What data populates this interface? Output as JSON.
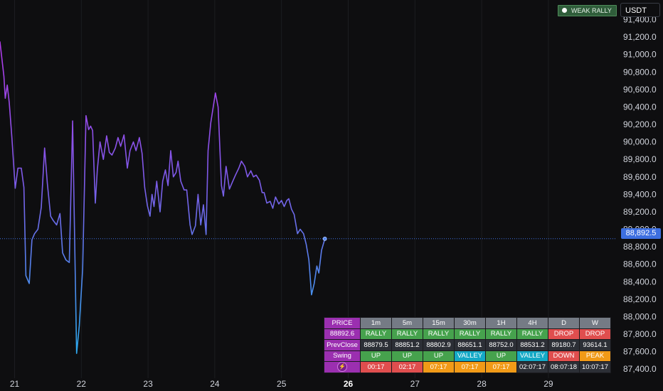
{
  "chart_data": {
    "type": "line",
    "x_ticks": [
      {
        "x": 21,
        "label": "21",
        "bold": false
      },
      {
        "x": 22,
        "label": "22",
        "bold": false
      },
      {
        "x": 23,
        "label": "23",
        "bold": false
      },
      {
        "x": 24,
        "label": "24",
        "bold": false
      },
      {
        "x": 25,
        "label": "25",
        "bold": false
      },
      {
        "x": 26,
        "label": "26",
        "bold": true
      },
      {
        "x": 27,
        "label": "27",
        "bold": false
      },
      {
        "x": 28,
        "label": "28",
        "bold": false
      },
      {
        "x": 29,
        "label": "29",
        "bold": false
      }
    ],
    "y_ticks": [
      {
        "v": 91400,
        "label": "91,400.0"
      },
      {
        "v": 91200,
        "label": "91,200.0"
      },
      {
        "v": 91000,
        "label": "91,000.0"
      },
      {
        "v": 90800,
        "label": "90,800.0"
      },
      {
        "v": 90600,
        "label": "90,600.0"
      },
      {
        "v": 90400,
        "label": "90,400.0"
      },
      {
        "v": 90200,
        "label": "90,200.0"
      },
      {
        "v": 90000,
        "label": "90,000.0"
      },
      {
        "v": 89800,
        "label": "89,800.0"
      },
      {
        "v": 89600,
        "label": "89,600.0"
      },
      {
        "v": 89400,
        "label": "89,400.0"
      },
      {
        "v": 89200,
        "label": "89,200.0"
      },
      {
        "v": 89000,
        "label": "89,000.0"
      },
      {
        "v": 88800,
        "label": "88,800.0"
      },
      {
        "v": 88600,
        "label": "88,600.0"
      },
      {
        "v": 88400,
        "label": "88,400.0"
      },
      {
        "v": 88200,
        "label": "88,200.0"
      },
      {
        "v": 88000,
        "label": "88,000.0"
      },
      {
        "v": 87800,
        "label": "87,800.0"
      },
      {
        "v": 87600,
        "label": "87,600.0"
      },
      {
        "v": 87400,
        "label": "87,400.0"
      }
    ],
    "ylim": [
      87296,
      91624
    ],
    "xlim": [
      20.78,
      30.0
    ],
    "last_price": 88892.5,
    "last_price_label": "88,892.5",
    "points": [
      [
        20.78,
        91150
      ],
      [
        20.84,
        90750
      ],
      [
        20.86,
        90500
      ],
      [
        20.89,
        90650
      ],
      [
        20.92,
        90450
      ],
      [
        20.96,
        90050
      ],
      [
        21.01,
        89470
      ],
      [
        21.05,
        89700
      ],
      [
        21.1,
        89700
      ],
      [
        21.14,
        89480
      ],
      [
        21.17,
        88470
      ],
      [
        21.22,
        88380
      ],
      [
        21.26,
        88880
      ],
      [
        21.3,
        88950
      ],
      [
        21.35,
        89000
      ],
      [
        21.4,
        89250
      ],
      [
        21.45,
        89930
      ],
      [
        21.49,
        89530
      ],
      [
        21.54,
        89150
      ],
      [
        21.58,
        89100
      ],
      [
        21.63,
        89050
      ],
      [
        21.68,
        89180
      ],
      [
        21.72,
        88730
      ],
      [
        21.77,
        88650
      ],
      [
        21.82,
        88620
      ],
      [
        21.87,
        90240
      ],
      [
        21.9,
        88900
      ],
      [
        21.93,
        87580
      ],
      [
        21.97,
        87900
      ],
      [
        22.02,
        88550
      ],
      [
        22.07,
        90300
      ],
      [
        22.11,
        90140
      ],
      [
        22.14,
        90180
      ],
      [
        22.17,
        90130
      ],
      [
        22.21,
        89300
      ],
      [
        22.24,
        89680
      ],
      [
        22.28,
        90000
      ],
      [
        22.33,
        89800
      ],
      [
        22.38,
        90070
      ],
      [
        22.42,
        89880
      ],
      [
        22.46,
        89850
      ],
      [
        22.51,
        89930
      ],
      [
        22.55,
        90050
      ],
      [
        22.59,
        89950
      ],
      [
        22.64,
        90080
      ],
      [
        22.69,
        89700
      ],
      [
        22.73,
        89900
      ],
      [
        22.78,
        90000
      ],
      [
        22.82,
        89900
      ],
      [
        22.87,
        90050
      ],
      [
        22.91,
        89870
      ],
      [
        22.95,
        89480
      ],
      [
        22.99,
        89270
      ],
      [
        23.03,
        89150
      ],
      [
        23.06,
        89400
      ],
      [
        23.09,
        89260
      ],
      [
        23.13,
        89550
      ],
      [
        23.18,
        89200
      ],
      [
        23.22,
        89550
      ],
      [
        23.26,
        89680
      ],
      [
        23.3,
        89500
      ],
      [
        23.34,
        89900
      ],
      [
        23.38,
        89600
      ],
      [
        23.42,
        89650
      ],
      [
        23.45,
        89780
      ],
      [
        23.49,
        89550
      ],
      [
        23.54,
        89450
      ],
      [
        23.58,
        89450
      ],
      [
        23.63,
        89050
      ],
      [
        23.66,
        88940
      ],
      [
        23.71,
        89040
      ],
      [
        23.75,
        89400
      ],
      [
        23.79,
        89050
      ],
      [
        23.83,
        89280
      ],
      [
        23.87,
        88940
      ],
      [
        23.9,
        89900
      ],
      [
        23.94,
        90220
      ],
      [
        24.01,
        90560
      ],
      [
        24.05,
        90400
      ],
      [
        24.1,
        89500
      ],
      [
        24.13,
        89380
      ],
      [
        24.17,
        89720
      ],
      [
        24.22,
        89460
      ],
      [
        24.27,
        89550
      ],
      [
        24.31,
        89620
      ],
      [
        24.36,
        89700
      ],
      [
        24.4,
        89780
      ],
      [
        24.45,
        89720
      ],
      [
        24.49,
        89600
      ],
      [
        24.54,
        89670
      ],
      [
        24.58,
        89600
      ],
      [
        24.62,
        89620
      ],
      [
        24.67,
        89560
      ],
      [
        24.71,
        89420
      ],
      [
        24.74,
        89420
      ],
      [
        24.78,
        89300
      ],
      [
        24.83,
        89320
      ],
      [
        24.87,
        89240
      ],
      [
        24.91,
        89370
      ],
      [
        24.96,
        89290
      ],
      [
        25.0,
        89330
      ],
      [
        25.04,
        89260
      ],
      [
        25.08,
        89330
      ],
      [
        25.11,
        89350
      ],
      [
        25.15,
        89230
      ],
      [
        25.19,
        89170
      ],
      [
        25.24,
        88950
      ],
      [
        25.28,
        89000
      ],
      [
        25.33,
        88950
      ],
      [
        25.37,
        88830
      ],
      [
        25.41,
        88650
      ],
      [
        25.45,
        88250
      ],
      [
        25.49,
        88380
      ],
      [
        25.53,
        88580
      ],
      [
        25.56,
        88500
      ],
      [
        25.6,
        88760
      ],
      [
        25.65,
        88892
      ]
    ]
  },
  "currency_label": "USDT",
  "status_badge": "WEAK RALLY",
  "table": {
    "headers": [
      "PRICE",
      "1m",
      "5m",
      "15m",
      "30m",
      "1H",
      "4H",
      "D",
      "W"
    ],
    "rows": [
      {
        "label": "88892.6",
        "cells": [
          {
            "text": "RALLY",
            "color": "green"
          },
          {
            "text": "RALLY",
            "color": "green"
          },
          {
            "text": "RALLY",
            "color": "green"
          },
          {
            "text": "RALLY",
            "color": "green"
          },
          {
            "text": "RALLY",
            "color": "green"
          },
          {
            "text": "RALLY",
            "color": "green"
          },
          {
            "text": "DROP",
            "color": "red"
          },
          {
            "text": "DROP",
            "color": "red"
          }
        ]
      },
      {
        "label": "PrevClose",
        "cells": [
          {
            "text": "88879.5",
            "color": "gray"
          },
          {
            "text": "88851.2",
            "color": "gray"
          },
          {
            "text": "88802.9",
            "color": "gray"
          },
          {
            "text": "88651.1",
            "color": "gray"
          },
          {
            "text": "88752.0",
            "color": "gray"
          },
          {
            "text": "88531.2",
            "color": "gray"
          },
          {
            "text": "89180.7",
            "color": "gray"
          },
          {
            "text": "93614.1",
            "color": "gray"
          }
        ]
      },
      {
        "label": "Swing",
        "cells": [
          {
            "text": "UP",
            "color": "green"
          },
          {
            "text": "UP",
            "color": "green"
          },
          {
            "text": "UP",
            "color": "green"
          },
          {
            "text": "VALLEY",
            "color": "cyan"
          },
          {
            "text": "UP",
            "color": "green"
          },
          {
            "text": "VALLEY",
            "color": "cyan"
          },
          {
            "text": "DOWN",
            "color": "red"
          },
          {
            "text": "PEAK",
            "color": "orange"
          }
        ]
      },
      {
        "label": "",
        "icon": "lightning-bolt-icon",
        "cells": [
          {
            "text": "00:17",
            "color": "t-red"
          },
          {
            "text": "02:17",
            "color": "t-red"
          },
          {
            "text": "07:17",
            "color": "t-orange"
          },
          {
            "text": "07:17",
            "color": "t-orange"
          },
          {
            "text": "07:17",
            "color": "t-orange"
          },
          {
            "text": "02:07:17",
            "color": "t-gray"
          },
          {
            "text": "08:07:18",
            "color": "t-gray"
          },
          {
            "text": "10:07:17",
            "color": "t-gray"
          }
        ]
      }
    ]
  },
  "colors": {
    "background": "#0e0e10",
    "grid": "#1c1d21",
    "line_top": "#a63be6",
    "line_bottom": "#3a8ff0",
    "last_price": "#3d6fe0"
  }
}
